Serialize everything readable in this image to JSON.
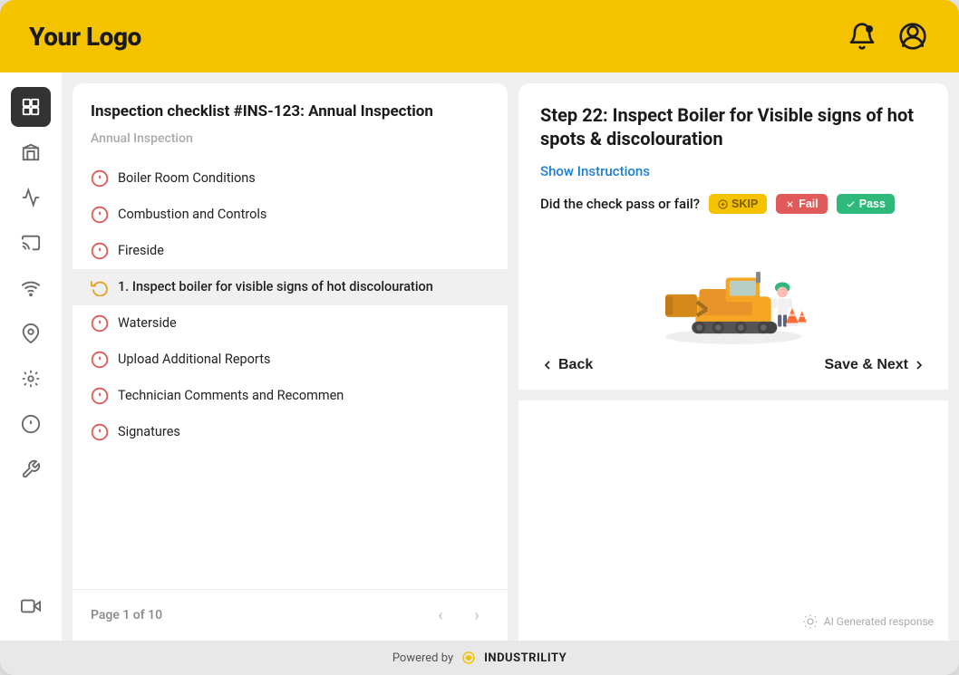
{
  "header": {
    "logo": "Your Logo",
    "bell_icon": "bell-icon",
    "user_icon": "user-icon"
  },
  "sidebar": {
    "items": [
      {
        "id": "grid",
        "icon": "grid-icon",
        "active": true
      },
      {
        "id": "building",
        "icon": "building-icon",
        "active": false
      },
      {
        "id": "chart",
        "icon": "chart-icon",
        "active": false
      },
      {
        "id": "cast",
        "icon": "cast-icon",
        "active": false
      },
      {
        "id": "wifi",
        "icon": "wifi-icon",
        "active": false
      },
      {
        "id": "location",
        "icon": "location-icon",
        "active": false
      },
      {
        "id": "integration",
        "icon": "integration-icon",
        "active": false
      },
      {
        "id": "alert",
        "icon": "alert-icon",
        "active": false
      },
      {
        "id": "wrench",
        "icon": "wrench-icon",
        "active": false
      },
      {
        "id": "video",
        "icon": "video-icon",
        "active": false
      }
    ]
  },
  "left_panel": {
    "title": "Inspection checklist #INS-123: Annual Inspection",
    "subtitle": "Annual Inspection",
    "items": [
      {
        "label": "Boiler Room Conditions",
        "icon": "exclaim",
        "active": false
      },
      {
        "label": "Combustion and Controls",
        "icon": "exclaim",
        "active": false
      },
      {
        "label": "Fireside",
        "icon": "exclaim",
        "active": false
      },
      {
        "label": "1. Inspect boiler for visible signs of hot discolouration",
        "icon": "refresh",
        "active": true
      },
      {
        "label": "Waterside",
        "icon": "exclaim",
        "active": false
      },
      {
        "label": "Upload Additional Reports",
        "icon": "exclaim",
        "active": false
      },
      {
        "label": "Technician Comments and Recommen",
        "icon": "exclaim",
        "active": false
      },
      {
        "label": "Signatures",
        "icon": "exclaim",
        "active": false
      }
    ],
    "footer": {
      "page_info": "Page 1 of 10",
      "prev_label": "‹",
      "next_label": "›"
    }
  },
  "right_panel": {
    "step_title": "Step 22: Inspect Boiler for Visible signs of hot spots & discolouration",
    "show_instructions_label": "Show Instructions",
    "check_question": "Did the check pass or fail?",
    "buttons": {
      "skip_label": "SKIP",
      "fail_label": "Fail",
      "pass_label": "Pass"
    },
    "navigation": {
      "back_label": "Back",
      "save_next_label": "Save & Next"
    },
    "ai_label": "AI Generated response"
  },
  "footer": {
    "powered_by": "Powered by",
    "brand": "INDUSTRILITY"
  }
}
